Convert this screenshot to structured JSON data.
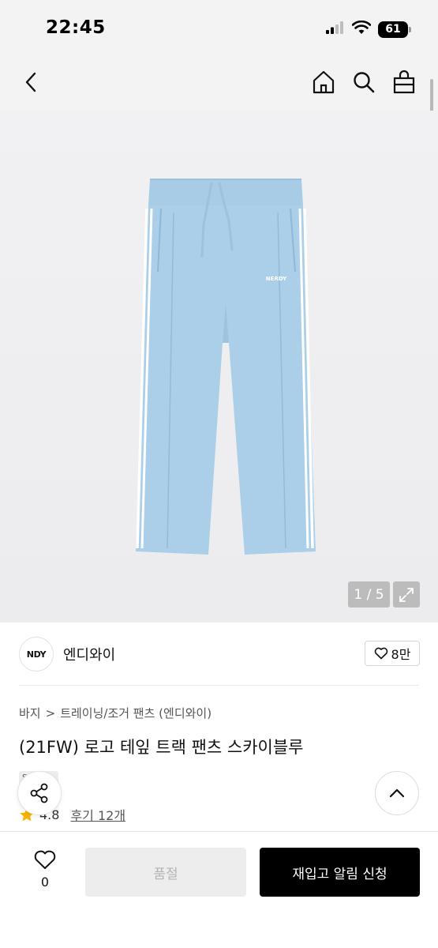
{
  "status_bar": {
    "time": "22:45",
    "battery": "61"
  },
  "gallery": {
    "counter": "1 / 5",
    "product_logo_text": "NERDY"
  },
  "brand": {
    "logo_text": "NDY",
    "name": "엔디와이",
    "likes": "8만"
  },
  "breadcrumb": {
    "category": "바지",
    "separator": ">",
    "subcategory": "트레이닝/조거 팬츠 (엔디와이)"
  },
  "product": {
    "title": "(21FW) 로고 테잎 트랙 팬츠 스카이블루",
    "tag": "S..."
  },
  "rating": {
    "value": "4.8",
    "reviews": "후기 12개"
  },
  "bottom_bar": {
    "wish_count": "0",
    "soldout_label": "품절",
    "restock_label": "재입고 알림 신청"
  },
  "colors": {
    "pants": "#a9cde8",
    "stripe": "#ffffff",
    "accent": "#f5b400",
    "primary_button": "#000000",
    "disabled_button": "#ededed"
  }
}
